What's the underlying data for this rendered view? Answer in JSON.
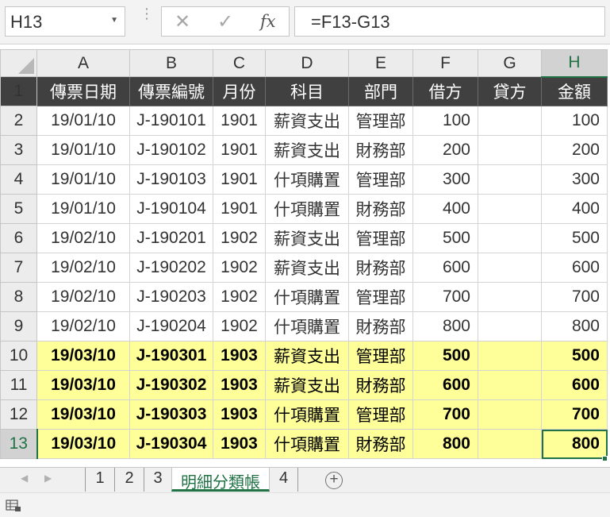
{
  "formula_bar": {
    "name_box": "H13",
    "cancel_glyph": "✕",
    "enter_glyph": "✓",
    "fx_label": "fx",
    "formula": "=F13-G13"
  },
  "columns": [
    "A",
    "B",
    "C",
    "D",
    "E",
    "F",
    "G",
    "H"
  ],
  "header_row": {
    "row_num": "1",
    "cells": [
      "傳票日期",
      "傳票編號",
      "月份",
      "科目",
      "部門",
      "借方",
      "貸方",
      "金額"
    ]
  },
  "rows": [
    {
      "row_num": "2",
      "cells": [
        "19/01/10",
        "J-190101",
        "1901",
        "薪資支出",
        "管理部",
        "100",
        "",
        "100"
      ]
    },
    {
      "row_num": "3",
      "cells": [
        "19/01/10",
        "J-190102",
        "1901",
        "薪資支出",
        "財務部",
        "200",
        "",
        "200"
      ]
    },
    {
      "row_num": "4",
      "cells": [
        "19/01/10",
        "J-190103",
        "1901",
        "什項購置",
        "管理部",
        "300",
        "",
        "300"
      ]
    },
    {
      "row_num": "5",
      "cells": [
        "19/01/10",
        "J-190104",
        "1901",
        "什項購置",
        "財務部",
        "400",
        "",
        "400"
      ]
    },
    {
      "row_num": "6",
      "cells": [
        "19/02/10",
        "J-190201",
        "1902",
        "薪資支出",
        "管理部",
        "500",
        "",
        "500"
      ]
    },
    {
      "row_num": "7",
      "cells": [
        "19/02/10",
        "J-190202",
        "1902",
        "薪資支出",
        "財務部",
        "600",
        "",
        "600"
      ]
    },
    {
      "row_num": "8",
      "cells": [
        "19/02/10",
        "J-190203",
        "1902",
        "什項購置",
        "管理部",
        "700",
        "",
        "700"
      ]
    },
    {
      "row_num": "9",
      "cells": [
        "19/02/10",
        "J-190204",
        "1902",
        "什項購置",
        "財務部",
        "800",
        "",
        "800"
      ]
    },
    {
      "row_num": "10",
      "cells": [
        "19/03/10",
        "J-190301",
        "1903",
        "薪資支出",
        "管理部",
        "500",
        "",
        "500"
      ]
    },
    {
      "row_num": "11",
      "cells": [
        "19/03/10",
        "J-190302",
        "1903",
        "薪資支出",
        "財務部",
        "600",
        "",
        "600"
      ]
    },
    {
      "row_num": "12",
      "cells": [
        "19/03/10",
        "J-190303",
        "1903",
        "什項購置",
        "管理部",
        "700",
        "",
        "700"
      ]
    },
    {
      "row_num": "13",
      "cells": [
        "19/03/10",
        "J-190304",
        "1903",
        "什項購置",
        "財務部",
        "800",
        "",
        "800"
      ]
    }
  ],
  "sheet_tabs": [
    "1",
    "2",
    "3",
    "明細分類帳",
    "4"
  ],
  "active_sheet": "明細分類帳",
  "add_sheet_glyph": "+",
  "colors": {
    "accent": "#217346",
    "header_fill": "#404040",
    "highlight_fill": "#ffff99"
  },
  "icons": {
    "name_box_dropdown": "chevron-down-icon",
    "status_mode": "sheet-view-icon"
  }
}
